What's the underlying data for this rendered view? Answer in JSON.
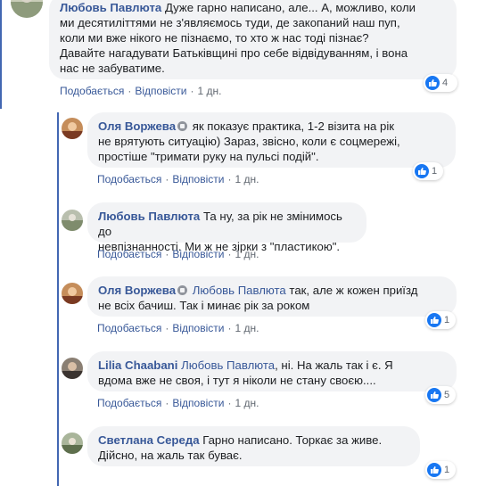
{
  "comments": [
    {
      "author": "Любовь Павлюта",
      "text": "Дуже гарно написано, але... А, можливо, коли ми десятиліттями не з'являємось туди, де закопаний наш пуп, коли ми вже нікого не пізнаємо, то хто ж нас тоді пізнає? Давайте нагадувати Батьківщині про себе відвідуванням, і вона нас не забуватиме.",
      "text_lines": [
        "Дуже гарно написано, але... А, можливо, коли",
        "ми десятиліттями не з'являємось туди, де закопаний наш пуп,",
        "коли ми вже нікого не пізнаємо, то хто ж нас тоді пізнає?",
        "Давайте нагадувати Батьківщині про себе відвідуванням, і вона",
        "нас не забуватиме."
      ],
      "like_label": "Подобається",
      "reply_label": "Відповісти",
      "time": "1 дн.",
      "reactions": "4"
    },
    {
      "author": "Оля Воржева",
      "text_lines": [
        "як показує практика, 1-2 візита на рік",
        "не врятують ситуацію) Зараз, звісно, коли є соцмережі,",
        "простіше \"тримати руку на пульсі подій\"."
      ],
      "like_label": "Подобається",
      "reply_label": "Відповісти",
      "time": "1 дн.",
      "reactions": "1"
    },
    {
      "author": "Любовь Павлюта",
      "text_lines": [
        "Та ну, за рік не змінимось до",
        "невпізнанності. Ми ж не зірки з \"пластикою\"."
      ],
      "like_label": "Подобається",
      "reply_label": "Відповісти",
      "time": "1 дн."
    },
    {
      "author": "Оля Воржева",
      "mention": "Любовь Павлюта",
      "text_lines": [
        "так, але ж кожен приїзд",
        "не всіх бачиш. Так і минає рік за роком"
      ],
      "like_label": "Подобається",
      "reply_label": "Відповісти",
      "time": "1 дн.",
      "reactions": "1"
    },
    {
      "author": "Lilia Chaabani",
      "mention": "Любовь Павлюта",
      "text_lines": [
        ", ні. На жаль так і є. Я",
        "вдома вже не своя, і тут я ніколи не стану своєю...."
      ],
      "like_label": "Подобається",
      "reply_label": "Відповісти",
      "time": "1 дн.",
      "reactions": "5"
    },
    {
      "author": "Светлана Середа",
      "text_lines": [
        "Гарно написано. Торкає за живе.",
        "Дійсно, на жаль так буває."
      ],
      "reactions": "1"
    }
  ],
  "colors": {
    "link": "#385898",
    "bubble": "#f2f3f5",
    "like_blue": "#1877f2",
    "thread_line": "#4267b2"
  }
}
